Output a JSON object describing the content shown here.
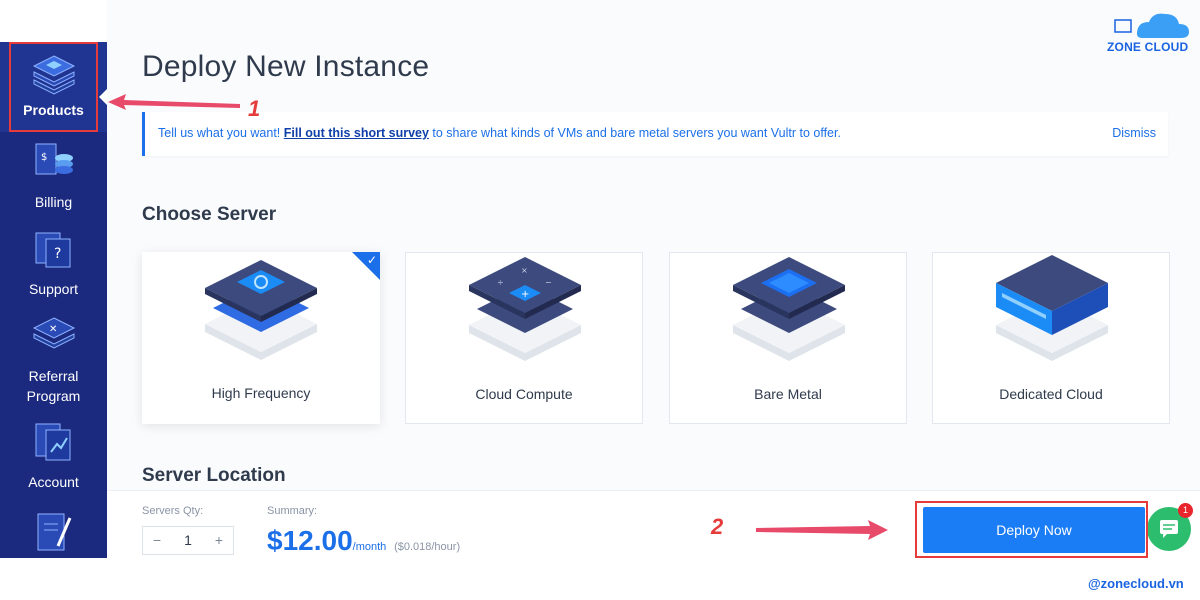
{
  "brand": {
    "name": "ZONE CLOUD",
    "watermark": "@zonecloud.vn"
  },
  "sidebar": {
    "items": [
      {
        "label": "Products",
        "icon": "layers-icon",
        "active": true
      },
      {
        "label": "Billing",
        "icon": "billing-icon",
        "active": false
      },
      {
        "label": "Support",
        "icon": "support-icon",
        "active": false
      },
      {
        "label": "Referral Program",
        "label_line1": "Referral",
        "label_line2": "Program",
        "icon": "referral-icon",
        "active": false
      },
      {
        "label": "Account",
        "icon": "account-icon",
        "active": false
      },
      {
        "label": "",
        "icon": "edit-icon",
        "active": false
      }
    ]
  },
  "page": {
    "title": "Deploy New Instance"
  },
  "survey": {
    "text_before": "Tell us what you want! ",
    "link": "Fill out this short survey",
    "text_after": " to share what kinds of VMs and bare metal servers you want Vultr to offer.",
    "dismiss": "Dismiss"
  },
  "choose_server": {
    "title": "Choose Server",
    "options": [
      {
        "name": "High Frequency",
        "selected": true
      },
      {
        "name": "Cloud Compute",
        "selected": false
      },
      {
        "name": "Bare Metal",
        "selected": false
      },
      {
        "name": "Dedicated Cloud",
        "selected": false
      }
    ]
  },
  "server_location": {
    "title": "Server Location"
  },
  "footer": {
    "qty_label": "Servers Qty:",
    "qty_value": "1",
    "minus": "−",
    "plus": "+",
    "summary_label": "Summary:",
    "price": "$12.00",
    "price_unit": "/month",
    "price_hour": "($0.018/hour)",
    "deploy": "Deploy Now",
    "chat_badge": "1"
  },
  "annotations": {
    "step1": "1",
    "step2": "2"
  },
  "colors": {
    "sidebar": "#1b2a7e",
    "accent": "#1b7df5",
    "annotation": "#e63b3b",
    "chat": "#2dbd6e"
  }
}
